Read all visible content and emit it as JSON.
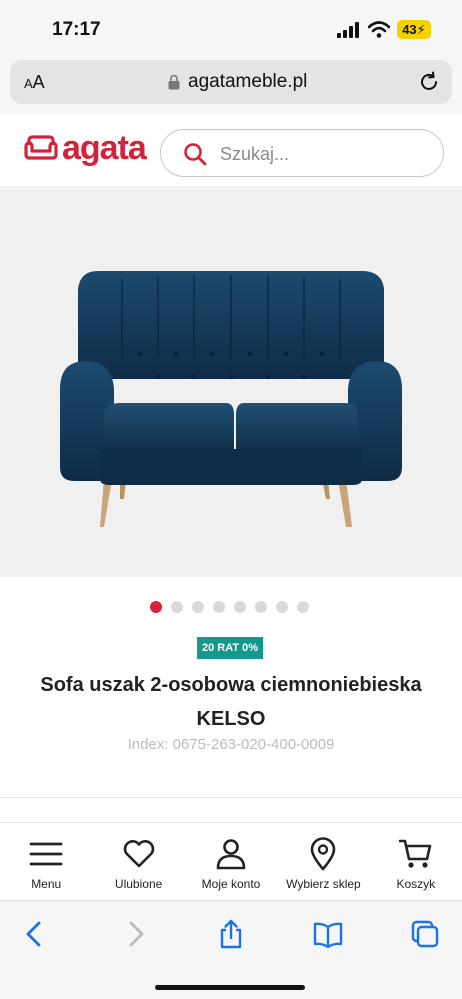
{
  "status": {
    "time": "17:17",
    "battery": "43"
  },
  "browser": {
    "text_size": "AA",
    "url": "agatameble.pl"
  },
  "site": {
    "logo": "agata",
    "search_placeholder": "Szukaj...",
    "brand_color": "#d6213a"
  },
  "carousel": {
    "count": 8,
    "active": 0
  },
  "product": {
    "badge": "20 RAT 0%",
    "title_line1": "Sofa uszak 2-osobowa ciemnoniebieska",
    "title_line2": "KELSO",
    "index": "Index: 0675-263-020-400-0009",
    "sofa_color": "#163a5a"
  },
  "bottom_nav": [
    {
      "label": "Menu",
      "icon": "menu-icon"
    },
    {
      "label": "Ulubione",
      "icon": "heart-icon"
    },
    {
      "label": "Moje konto",
      "icon": "user-icon"
    },
    {
      "label": "Wybierz sklep",
      "icon": "location-pin-icon"
    },
    {
      "label": "Koszyk",
      "icon": "cart-icon"
    }
  ],
  "toolbar": [
    "back-icon",
    "forward-icon",
    "share-icon",
    "bookmarks-icon",
    "tabs-icon"
  ]
}
